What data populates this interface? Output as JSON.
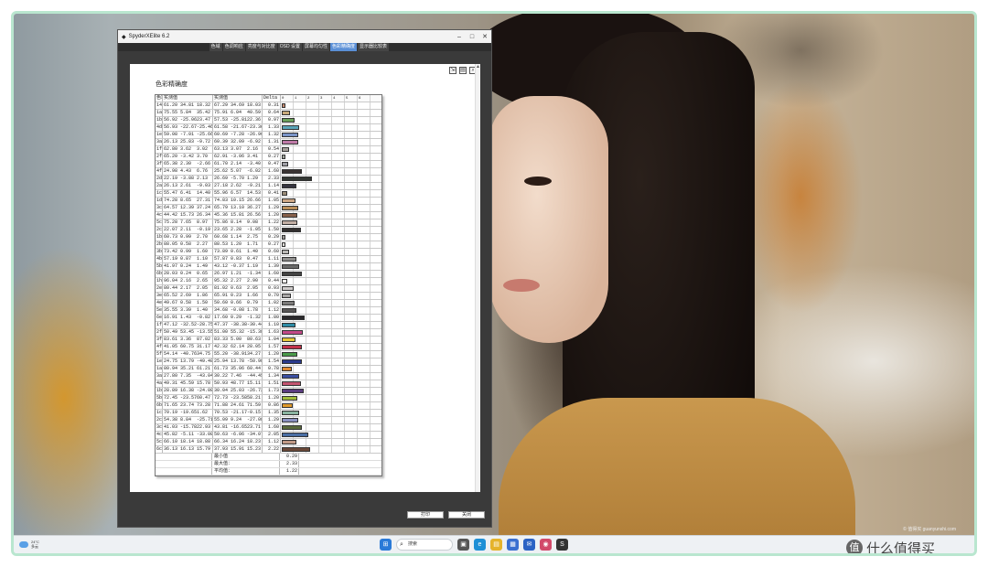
{
  "window": {
    "title": "SpyderXElite 6.2",
    "tabs": [
      "色域",
      "色调响应",
      "亮度与对比度",
      "OSD 设置",
      "屏幕均匀性",
      "色彩精确度",
      "显示器比较表"
    ],
    "active_tab": 5
  },
  "report": {
    "title": "色彩精确度",
    "columns": [
      "色块",
      "实测值",
      "",
      "",
      "参照",
      "实测值",
      "",
      "",
      "Delta E"
    ],
    "scale": [
      "0",
      "1",
      "2",
      "3",
      "4",
      "5",
      "6"
    ],
    "rows": [
      {
        "id": "14",
        "a": "61.20",
        "b": "34.81",
        "c": "18.32",
        "d": "67.29",
        "e": "34.69",
        "f": "18.03",
        "de": "0.31",
        "color": "#c68a70"
      },
      {
        "id": "1a",
        "a": "75.55",
        "b": "5.84",
        "c": "35.42",
        "d": "75.91",
        "e": "6.04",
        "f": "40.59",
        "de": "0.64",
        "color": "#c8aa7a"
      },
      {
        "id": "1b",
        "a": "56.92",
        "b": "-25.06",
        "c": "23.47",
        "d": "57.53",
        "e": "-25.81",
        "f": "22.36",
        "de": "0.97",
        "color": "#6aa05a"
      },
      {
        "id": "4d",
        "a": "56.93",
        "b": "-22.67",
        "c": "-25.46",
        "d": "61.58",
        "e": "-21.67",
        "f": "-23.36",
        "de": "1.33",
        "color": "#5aa4b8"
      },
      {
        "id": "1e",
        "a": "59.08",
        "b": "-7.01",
        "c": "-25.66",
        "d": "60.69",
        "e": "-7.28",
        "f": "-26.90",
        "de": "1.32",
        "color": "#7a94c8"
      },
      {
        "id": "3a",
        "a": "26.13",
        "b": "25.83",
        "c": "-9.72",
        "d": "60.39",
        "e": "32.09",
        "f": "-6.92",
        "de": "1.31",
        "color": "#c07aa8"
      },
      {
        "id": "1f",
        "a": "62.80",
        "b": "3.62",
        "c": "3.02",
        "d": "63.13",
        "e": "3.07",
        "f": "2.16",
        "de": "0.54",
        "color": "#a6a09a"
      },
      {
        "id": "2f",
        "a": "65.20",
        "b": "-3.42",
        "c": "3.70",
        "d": "62.91",
        "e": "-3.06",
        "f": "3.41",
        "de": "0.27",
        "color": "#9ea39a"
      },
      {
        "id": "3f",
        "a": "65.38",
        "b": "2.30",
        "c": "-2.66",
        "d": "61.70",
        "e": "2.14",
        "f": "-3.40",
        "de": "0.47",
        "color": "#a0a0a6"
      },
      {
        "id": "4f",
        "a": "24.98",
        "b": "4.43",
        "c": "6.76",
        "d": "25.62",
        "e": "5.07",
        "f": "-6.02",
        "de": "1.60",
        "color": "#3a3433"
      },
      {
        "id": "2d",
        "a": "22.19",
        "b": "-3.88",
        "c": "2.13",
        "d": "26.69",
        "e": "-5.70",
        "f": "1.29",
        "de": "2.33",
        "color": "#333733"
      },
      {
        "id": "2a",
        "a": "26.13",
        "b": "2.61",
        "c": "-9.03",
        "d": "27.18",
        "e": "2.62",
        "f": "-9.21",
        "de": "1.14",
        "color": "#363540"
      },
      {
        "id": "1c",
        "a": "55.47",
        "b": "6.41",
        "c": "14.40",
        "d": "55.96",
        "e": "6.57",
        "f": "14.53",
        "de": "0.41",
        "color": "#9a8c78"
      },
      {
        "id": "1d",
        "a": "74.28",
        "b": "8.65",
        "c": "27.31",
        "d": "74.83",
        "e": "10.15",
        "f": "26.66",
        "de": "1.05",
        "color": "#cca684"
      },
      {
        "id": "3c",
        "a": "64.57",
        "b": "12.39",
        "c": "37.24",
        "d": "65.79",
        "e": "13.10",
        "f": "36.27",
        "de": "1.29",
        "color": "#b98e5a"
      },
      {
        "id": "4c",
        "a": "44.42",
        "b": "15.73",
        "c": "26.34",
        "d": "45.36",
        "e": "15.81",
        "f": "26.56",
        "de": "1.20",
        "color": "#86604a"
      },
      {
        "id": "5c",
        "a": "75.28",
        "b": "7.65",
        "c": "8.97",
        "d": "75.86",
        "e": "8.14",
        "f": "9.08",
        "de": "1.22",
        "color": "#c2aea4"
      },
      {
        "id": "2c",
        "a": "22.07",
        "b": "2.11",
        "c": "-0.19",
        "d": "23.65",
        "e": "2.28",
        "f": "-1.05",
        "de": "1.50",
        "color": "#33302f"
      },
      {
        "id": "1b",
        "a": "60.73",
        "b": "0.99",
        "c": "2.70",
        "d": "60.68",
        "e": "1.14",
        "f": "2.75",
        "de": "0.29",
        "color": "#9c9a96"
      },
      {
        "id": "2b",
        "a": "88.05",
        "b": "0.58",
        "c": "2.27",
        "d": "88.53",
        "e": "1.20",
        "f": "1.71",
        "de": "0.27",
        "color": "#dcdad6"
      },
      {
        "id": "3b",
        "a": "73.42",
        "b": "0.99",
        "c": "1.60",
        "d": "73.89",
        "e": "0.61",
        "f": "1.40",
        "de": "0.60",
        "color": "#bab9b6"
      },
      {
        "id": "4b",
        "a": "57.19",
        "b": "0.87",
        "c": "1.10",
        "d": "57.87",
        "e": "0.83",
        "f": "0.47",
        "de": "1.11",
        "color": "#8f8e8c"
      },
      {
        "id": "5b",
        "a": "41.97",
        "b": "0.24",
        "c": "1.49",
        "d": "43.12",
        "e": "-0.37",
        "f": "1.19",
        "de": "1.39",
        "color": "#6a6a69"
      },
      {
        "id": "6b",
        "a": "28.03",
        "b": "0.24",
        "c": "0.65",
        "d": "26.97",
        "e": "1.21",
        "f": "-1.34",
        "de": "1.60",
        "color": "#444443"
      },
      {
        "id": "1h",
        "a": "96.04",
        "b": "2.16",
        "c": "2.65",
        "d": "95.32",
        "e": "2.27",
        "f": "2.90",
        "de": "0.44",
        "color": "#f2f0ec"
      },
      {
        "id": "2e",
        "a": "80.44",
        "b": "2.17",
        "c": "2.05",
        "d": "81.02",
        "e": "0.63",
        "f": "2.95",
        "de": "0.93",
        "color": "#cfcccb"
      },
      {
        "id": "3e",
        "a": "65.52",
        "b": "2.69",
        "c": "1.86",
        "d": "65.91",
        "e": "0.23",
        "f": "1.66",
        "de": "0.70",
        "color": "#a9a7a6"
      },
      {
        "id": "4e",
        "a": "49.67",
        "b": "0.58",
        "c": "1.50",
        "d": "50.60",
        "e": "0.66",
        "f": "0.79",
        "de": "1.02",
        "color": "#7c7b7a"
      },
      {
        "id": "5e",
        "a": "35.55",
        "b": "3.39",
        "c": "1.40",
        "d": "34.68",
        "e": "-0.08",
        "f": "1.78",
        "de": "1.12",
        "color": "#585656"
      },
      {
        "id": "6e",
        "a": "16.91",
        "b": "1.43",
        "c": "-0.82",
        "d": "17.60",
        "e": "0.29",
        "f": "-1.32",
        "de": "1.80",
        "color": "#2a292b"
      },
      {
        "id": "1f",
        "a": "47.12",
        "b": "-32.52",
        "c": "-28.75",
        "d": "47.37",
        "e": "-38.38",
        "f": "-30.44",
        "de": "1.10",
        "color": "#2e8ca6"
      },
      {
        "id": "2f",
        "a": "50.49",
        "b": "53.45",
        "c": "-13.55",
        "d": "51.00",
        "e": "55.32",
        "f": "-15.38",
        "de": "1.63",
        "color": "#c24a88"
      },
      {
        "id": "3f",
        "a": "83.61",
        "b": "3.36",
        "c": "87.02",
        "d": "83.33",
        "e": "5.00",
        "f": "80.63",
        "de": "1.04",
        "color": "#e6c838"
      },
      {
        "id": "4f",
        "a": "41.05",
        "b": "60.75",
        "c": "31.17",
        "d": "42.32",
        "e": "62.14",
        "f": "28.05",
        "de": "1.57",
        "color": "#c2324a"
      },
      {
        "id": "5f",
        "a": "54.14",
        "b": "-40.76",
        "c": "34.75",
        "d": "55.20",
        "e": "-38.91",
        "f": "34.27",
        "de": "1.20",
        "color": "#4a9a4a"
      },
      {
        "id": "1e",
        "a": "24.75",
        "b": "13.79",
        "c": "-49.48",
        "d": "25.94",
        "e": "13.78",
        "f": "-50.98",
        "de": "1.54",
        "color": "#2a3a8c"
      },
      {
        "id": "1a",
        "a": "80.94",
        "b": "35.21",
        "c": "61.21",
        "d": "61.73",
        "e": "35.06",
        "f": "60.44",
        "de": "0.78",
        "color": "#e08a34"
      },
      {
        "id": "3a",
        "a": "27.80",
        "b": "7.35",
        "c": "-43.04",
        "d": "30.22",
        "e": "7.46",
        "f": "-44.45",
        "de": "1.34",
        "color": "#3a4ea0"
      },
      {
        "id": "4a",
        "a": "49.31",
        "b": "45.59",
        "c": "15.78",
        "d": "50.93",
        "e": "48.77",
        "f": "15.11",
        "de": "1.51",
        "color": "#c25470"
      },
      {
        "id": "1b",
        "a": "28.89",
        "b": "16.38",
        "c": "-24.08",
        "d": "30.04",
        "e": "25.03",
        "f": "-26.72",
        "de": "1.73",
        "color": "#5a3c80"
      },
      {
        "id": "5b",
        "a": "72.45",
        "b": "-23.57",
        "c": "60.47",
        "d": "72.73",
        "e": "-23.58",
        "f": "58.21",
        "de": "1.20",
        "color": "#a0bc3c"
      },
      {
        "id": "6b",
        "a": "71.65",
        "b": "23.74",
        "c": "73.28",
        "d": "71.88",
        "e": "24.61",
        "f": "71.59",
        "de": "0.86",
        "color": "#e09a2c"
      },
      {
        "id": "1c",
        "a": "70.19",
        "b": "-19.65",
        "c": "1.62",
        "d": "70.53",
        "e": "-21.17",
        "f": "-0.15",
        "de": "1.35",
        "color": "#8ab4a0"
      },
      {
        "id": "2c",
        "a": "54.38",
        "b": "8.84",
        "c": "-25.71",
        "d": "55.09",
        "e": "9.24",
        "f": "-27.08",
        "de": "1.29",
        "color": "#8a90c0"
      },
      {
        "id": "3c",
        "a": "41.03",
        "b": "-15.78",
        "c": "22.93",
        "d": "43.81",
        "e": "-16.65",
        "f": "23.71",
        "de": "1.60",
        "color": "#5a6a3a"
      },
      {
        "id": "4c",
        "a": "45.82",
        "b": "-5.11",
        "c": "-33.08",
        "d": "50.63",
        "e": "-6.06",
        "f": "-34.07",
        "de": "2.05",
        "color": "#4a6ea4"
      },
      {
        "id": "5c",
        "a": "66.10",
        "b": "18.14",
        "c": "18.88",
        "d": "66.34",
        "e": "16.24",
        "f": "18.23",
        "de": "1.12",
        "color": "#c29a86"
      },
      {
        "id": "6c",
        "a": "36.13",
        "b": "16.13",
        "c": "15.79",
        "d": "37.93",
        "e": "15.91",
        "f": "15.23",
        "de": "2.22",
        "color": "#6a4838"
      }
    ],
    "summary": [
      {
        "label": "最小值",
        "value": "0.29"
      },
      {
        "label": "最大值：",
        "value": "2.33"
      },
      {
        "label": "平均值：",
        "value": "1.22"
      }
    ],
    "buttons": {
      "print": "打印",
      "close": "关闭"
    }
  },
  "taskbar": {
    "weather_temp": "24°C",
    "weather_desc": "多云",
    "search_placeholder": "搜索",
    "apps": [
      {
        "name": "start",
        "glyph": "⊞",
        "color": "#2a7ad8"
      },
      {
        "name": "task-view",
        "glyph": "▣",
        "color": "#555555"
      },
      {
        "name": "edge",
        "glyph": "e",
        "color": "#1d8fd6"
      },
      {
        "name": "file-explorer",
        "glyph": "▤",
        "color": "#e5b32b"
      },
      {
        "name": "store",
        "glyph": "▦",
        "color": "#3a6fd0"
      },
      {
        "name": "mail",
        "glyph": "✉",
        "color": "#2b62c4"
      },
      {
        "name": "photos",
        "glyph": "◉",
        "color": "#d24a6a"
      },
      {
        "name": "spyder",
        "glyph": "S",
        "color": "#333333"
      }
    ]
  },
  "watermark": "© 值得买 guanyunshi.com",
  "brand": "什么值得买",
  "colors": {
    "accent_frame": "#b9e6cf",
    "active_tab": "#5a8fd6"
  }
}
